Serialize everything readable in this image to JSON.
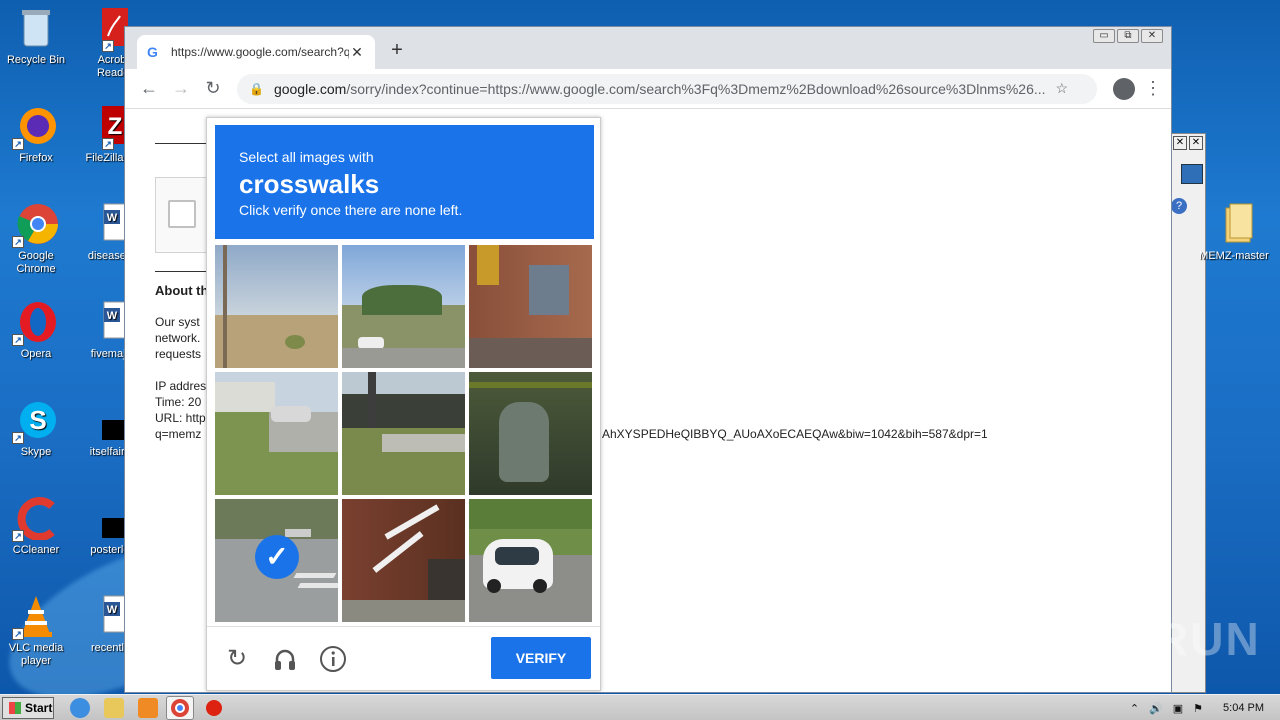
{
  "desktop": {
    "icons_left": [
      {
        "label": "Recycle Bin",
        "icon": "recycle-bin-icon"
      },
      {
        "label": "Firefox",
        "icon": "firefox-icon"
      },
      {
        "label": "Google Chrome",
        "icon": "chrome-icon"
      },
      {
        "label": "Opera",
        "icon": "opera-icon"
      },
      {
        "label": "Skype",
        "icon": "skype-icon"
      },
      {
        "label": "CCleaner",
        "icon": "ccleaner-icon"
      },
      {
        "label": "VLC media player",
        "icon": "vlc-icon"
      }
    ],
    "icons_col2": [
      {
        "label": "Acroba Reader",
        "icon": "acrobat-icon"
      },
      {
        "label": "FileZilla C",
        "icon": "filezilla-icon"
      },
      {
        "label": "diseasega",
        "icon": "word-doc-icon"
      },
      {
        "label": "fivemajor",
        "icon": "word-doc-icon"
      },
      {
        "label": "itselfairpc",
        "icon": "black-file-icon"
      },
      {
        "label": "posterlea",
        "icon": "black-file-icon"
      },
      {
        "label": "recentlyc",
        "icon": "word-doc-icon"
      }
    ],
    "right_icon": {
      "label": "MEMZ-master",
      "icon": "folder-icon"
    },
    "watermark": "ANY RUN"
  },
  "browser": {
    "tab_title": "https://www.google.com/search?q=",
    "url_host": "google.com",
    "url_path": "/sorry/index?continue=https://www.google.com/search%3Fq%3Dmemz%2Bdownload%26source%3Dlnms%26...",
    "win_buttons": [
      "▭",
      "⧉",
      "✕"
    ]
  },
  "page": {
    "about_heading": "About th",
    "body_lines": [
      "Our syst",
      "network.",
      "requests"
    ],
    "ip_line": "IP addres",
    "time_line": "Time: 20",
    "url_line": "URL: http",
    "url_line2": "q=memz",
    "url_tail": "AhXYSPEDHeQIBBYQ_AUoAXoECAEQAw&biw=1042&bih=587&dpr=1"
  },
  "captcha": {
    "line1": "Select all images with",
    "keyword": "crosswalks",
    "line3": "Click verify once there are none left.",
    "verify_label": "VERIFY",
    "tiles": [
      {
        "scene": "field with pole",
        "selected": false
      },
      {
        "scene": "palm trees and car",
        "selected": false
      },
      {
        "scene": "building with traffic light",
        "selected": false
      },
      {
        "scene": "house with car",
        "selected": false
      },
      {
        "scene": "overpass",
        "selected": false
      },
      {
        "scene": "statue",
        "selected": false
      },
      {
        "scene": "street crosswalk",
        "selected": true
      },
      {
        "scene": "stairs",
        "selected": false
      },
      {
        "scene": "small car",
        "selected": false
      }
    ]
  },
  "taskbar": {
    "start_label": "Start",
    "clock": "5:04 PM"
  }
}
